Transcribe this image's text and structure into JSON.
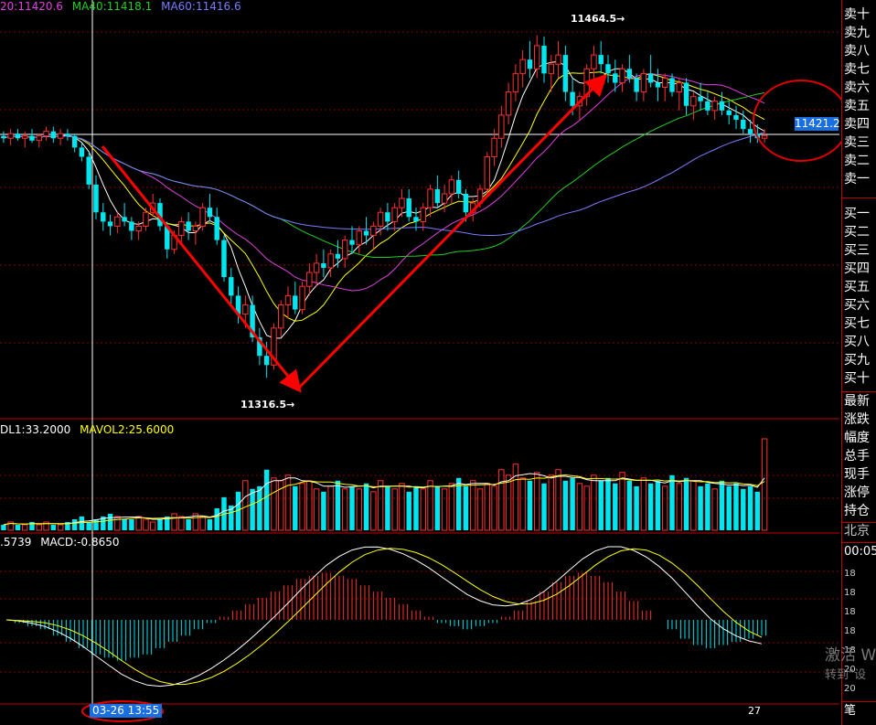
{
  "legends": {
    "price": [
      {
        "text": "20:11420.6",
        "color": "#e040e0"
      },
      {
        "text": "MA40:11418.1",
        "color": "#20d020"
      },
      {
        "text": "MA60:11416.6",
        "color": "#7b7bff"
      }
    ],
    "volume": [
      {
        "text": "DL1:33.2000",
        "color": "#ffffff"
      },
      {
        "text": "MAVOL2:25.6000",
        "color": "#ffff00"
      }
    ],
    "macd": [
      {
        "text": ".5739",
        "color": "#ffffff"
      },
      {
        "text": "MACD:-0.8650",
        "color": "#ffffff"
      }
    ]
  },
  "annotations": {
    "high_label": "11464.5",
    "low_label": "11316.5",
    "current_price": "11421.2",
    "crosshair_date": "03-26 13:55",
    "bottom_axis_tick": "27"
  },
  "side_panel": {
    "sell_levels": [
      "卖十",
      "卖九",
      "卖八",
      "卖七",
      "卖六",
      "卖五",
      "卖四",
      "卖三",
      "卖二",
      "卖一"
    ],
    "buy_levels": [
      "买一",
      "买二",
      "买三",
      "买四",
      "买五",
      "买六",
      "买七",
      "买八",
      "买九",
      "买十"
    ],
    "fields": [
      "最新",
      "涨跌",
      "幅度",
      "总手",
      "现手",
      "涨停",
      "持仓"
    ],
    "city": "北京",
    "time": "00:05",
    "right_axis_fragments": [
      "18",
      "18",
      "18",
      "18",
      "18",
      "20",
      "20"
    ],
    "bottom_glyph": "笔"
  },
  "watermark": {
    "line1": "激活 W",
    "line2": "转到\"设"
  },
  "colors": {
    "up": "#ff3030",
    "down": "#00e5ee",
    "grid": "#8b0000",
    "arrow": "#ff0000",
    "circle": "#e00000"
  },
  "chart_data": {
    "type": "candlestick",
    "title": "",
    "price_axis_range": [
      11300,
      11475
    ],
    "price_high": 11464.5,
    "price_low": 11316.5,
    "current_price": 11421.2,
    "candles_ohlc": [
      [
        11421,
        11423,
        11418,
        11420
      ],
      [
        11420,
        11424,
        11417,
        11422
      ],
      [
        11422,
        11424,
        11419,
        11420
      ],
      [
        11420,
        11423,
        11416,
        11421
      ],
      [
        11421,
        11424,
        11418,
        11419
      ],
      [
        11419,
        11422,
        11416,
        11421
      ],
      [
        11421,
        11425,
        11419,
        11423
      ],
      [
        11423,
        11425,
        11418,
        11420
      ],
      [
        11420,
        11424,
        11417,
        11422
      ],
      [
        11422,
        11424,
        11419,
        11421
      ],
      [
        11421,
        11422,
        11414,
        11416
      ],
      [
        11416,
        11418,
        11410,
        11412
      ],
      [
        11412,
        11414,
        11398,
        11400
      ],
      [
        11400,
        11404,
        11385,
        11388
      ],
      [
        11388,
        11392,
        11380,
        11384
      ],
      [
        11384,
        11387,
        11378,
        11382
      ],
      [
        11382,
        11388,
        11379,
        11386
      ],
      [
        11386,
        11392,
        11382,
        11384
      ],
      [
        11384,
        11386,
        11376,
        11380
      ],
      [
        11380,
        11384,
        11376,
        11382
      ],
      [
        11382,
        11390,
        11380,
        11388
      ],
      [
        11388,
        11396,
        11386,
        11392
      ],
      [
        11392,
        11394,
        11380,
        11382
      ],
      [
        11382,
        11384,
        11368,
        11372
      ],
      [
        11372,
        11380,
        11370,
        11378
      ],
      [
        11378,
        11386,
        11374,
        11384
      ],
      [
        11384,
        11388,
        11376,
        11380
      ],
      [
        11380,
        11384,
        11374,
        11382
      ],
      [
        11382,
        11392,
        11380,
        11390
      ],
      [
        11390,
        11396,
        11384,
        11386
      ],
      [
        11386,
        11390,
        11374,
        11376
      ],
      [
        11376,
        11378,
        11358,
        11360
      ],
      [
        11360,
        11364,
        11348,
        11352
      ],
      [
        11352,
        11356,
        11340,
        11344
      ],
      [
        11344,
        11352,
        11338,
        11348
      ],
      [
        11348,
        11352,
        11332,
        11334
      ],
      [
        11334,
        11338,
        11322,
        11326
      ],
      [
        11326,
        11332,
        11316.5,
        11322
      ],
      [
        11322,
        11340,
        11320,
        11338
      ],
      [
        11338,
        11350,
        11334,
        11348
      ],
      [
        11348,
        11356,
        11342,
        11352
      ],
      [
        11352,
        11358,
        11344,
        11346
      ],
      [
        11346,
        11358,
        11344,
        11356
      ],
      [
        11356,
        11366,
        11352,
        11362
      ],
      [
        11362,
        11370,
        11356,
        11366
      ],
      [
        11366,
        11372,
        11360,
        11364
      ],
      [
        11364,
        11372,
        11360,
        11370
      ],
      [
        11370,
        11376,
        11364,
        11368
      ],
      [
        11368,
        11378,
        11364,
        11376
      ],
      [
        11376,
        11382,
        11370,
        11374
      ],
      [
        11374,
        11382,
        11370,
        11380
      ],
      [
        11380,
        11386,
        11374,
        11378
      ],
      [
        11378,
        11384,
        11372,
        11382
      ],
      [
        11382,
        11390,
        11378,
        11388
      ],
      [
        11388,
        11392,
        11380,
        11384
      ],
      [
        11384,
        11392,
        11380,
        11390
      ],
      [
        11390,
        11398,
        11386,
        11394
      ],
      [
        11394,
        11398,
        11384,
        11386
      ],
      [
        11386,
        11390,
        11380,
        11384
      ],
      [
        11384,
        11392,
        11380,
        11390
      ],
      [
        11390,
        11400,
        11386,
        11398
      ],
      [
        11398,
        11404,
        11390,
        11392
      ],
      [
        11392,
        11400,
        11388,
        11396
      ],
      [
        11396,
        11404,
        11392,
        11402
      ],
      [
        11402,
        11406,
        11394,
        11396
      ],
      [
        11396,
        11398,
        11384,
        11388
      ],
      [
        11388,
        11394,
        11384,
        11392
      ],
      [
        11392,
        11400,
        11390,
        11398
      ],
      [
        11398,
        11414,
        11396,
        11412
      ],
      [
        11412,
        11424,
        11408,
        11420
      ],
      [
        11420,
        11434,
        11416,
        11430
      ],
      [
        11430,
        11444,
        11426,
        11440
      ],
      [
        11440,
        11452,
        11436,
        11448
      ],
      [
        11448,
        11458,
        11442,
        11454
      ],
      [
        11454,
        11462,
        11446,
        11450
      ],
      [
        11450,
        11464.5,
        11446,
        11460
      ],
      [
        11460,
        11464,
        11444,
        11448
      ],
      [
        11448,
        11456,
        11440,
        11452
      ],
      [
        11452,
        11462,
        11446,
        11456
      ],
      [
        11456,
        11460,
        11436,
        11440
      ],
      [
        11440,
        11446,
        11430,
        11434
      ],
      [
        11434,
        11440,
        11428,
        11438
      ],
      [
        11438,
        11452,
        11434,
        11450
      ],
      [
        11450,
        11460,
        11444,
        11456
      ],
      [
        11456,
        11462,
        11448,
        11452
      ],
      [
        11452,
        11456,
        11444,
        11448
      ],
      [
        11448,
        11454,
        11440,
        11444
      ],
      [
        11444,
        11452,
        11440,
        11450
      ],
      [
        11450,
        11456,
        11444,
        11446
      ],
      [
        11446,
        11448,
        11436,
        11440
      ],
      [
        11440,
        11450,
        11436,
        11448
      ],
      [
        11448,
        11456,
        11442,
        11444
      ],
      [
        11444,
        11450,
        11436,
        11442
      ],
      [
        11442,
        11448,
        11436,
        11446
      ],
      [
        11446,
        11448,
        11438,
        11440
      ],
      [
        11440,
        11446,
        11432,
        11444
      ],
      [
        11444,
        11446,
        11430,
        11434
      ],
      [
        11434,
        11440,
        11428,
        11438
      ],
      [
        11438,
        11444,
        11432,
        11436
      ],
      [
        11436,
        11440,
        11430,
        11432
      ],
      [
        11432,
        11438,
        11428,
        11436
      ],
      [
        11436,
        11440,
        11430,
        11432
      ],
      [
        11432,
        11436,
        11426,
        11430
      ],
      [
        11430,
        11434,
        11424,
        11428
      ],
      [
        11428,
        11432,
        11422,
        11424
      ],
      [
        11424,
        11428,
        11418,
        11422
      ],
      [
        11422,
        11426,
        11418,
        11420
      ],
      [
        11420,
        11424,
        11418,
        11421.2
      ]
    ],
    "ma_latest": {
      "MA20": 11420.6,
      "MA40": 11418.1,
      "MA60": 11416.6
    },
    "volume_latest": {
      "VOL": 33.2,
      "MAVOL2": 25.6
    },
    "volume": [
      2,
      3,
      2,
      2,
      3,
      2,
      3,
      2,
      2,
      3,
      4,
      5,
      3,
      4,
      5,
      6,
      5,
      4,
      4,
      5,
      4,
      3,
      4,
      5,
      6,
      5,
      4,
      6,
      5,
      4,
      8,
      12,
      9,
      14,
      18,
      15,
      16,
      22,
      19,
      18,
      20,
      16,
      17,
      18,
      15,
      14,
      16,
      18,
      15,
      16,
      15,
      17,
      14,
      18,
      16,
      15,
      17,
      14,
      16,
      15,
      18,
      16,
      15,
      17,
      19,
      16,
      18,
      15,
      17,
      16,
      22,
      20,
      24,
      19,
      18,
      21,
      17,
      20,
      22,
      18,
      19,
      17,
      16,
      20,
      18,
      19,
      17,
      21,
      18,
      16,
      19,
      17,
      18,
      16,
      20,
      17,
      19,
      18,
      16,
      17,
      15,
      18,
      16,
      17,
      15,
      16,
      14,
      33.2
    ],
    "macd_latest": {
      "DIF": 0.5739,
      "MACD": -0.865
    },
    "macd_hist": [
      0,
      -0.5,
      -1,
      -1.5,
      -2.5,
      -3.5,
      -4.5,
      -5.5,
      -6,
      -6.5,
      -6,
      -5.5,
      -4.5,
      -3.5,
      -2.5,
      -1.5,
      -0.5,
      0.5,
      1.5,
      2.5,
      3.5,
      4.5,
      5.5,
      6.5,
      7,
      7.5,
      7,
      6.5,
      5.5,
      4.5,
      3.5,
      2.5,
      1.5,
      0.5,
      -0.5,
      -1,
      -1.5,
      -1,
      -0.5,
      0.5,
      1.5,
      3,
      4.5,
      6,
      7,
      7.5,
      7,
      6,
      4.5,
      3,
      1.5,
      0,
      -1.5,
      -3,
      -4,
      -4.5,
      -4,
      -3.5,
      -3,
      -2.5
    ]
  }
}
